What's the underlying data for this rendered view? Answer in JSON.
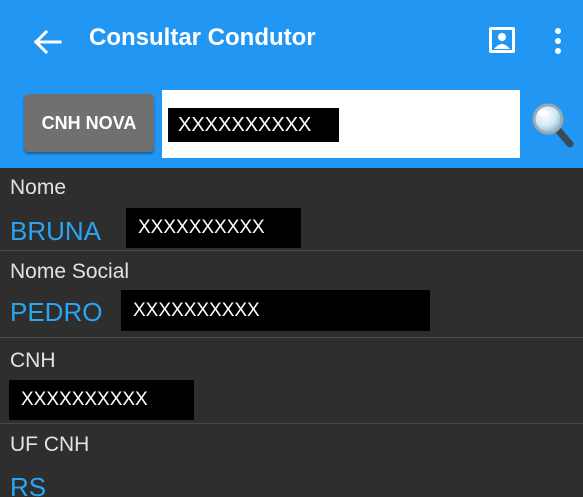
{
  "appbar": {
    "title": "Consultar Condutor",
    "back_icon": "arrow-left-icon",
    "contact_icon": "contact-card-icon",
    "menu_icon": "more-vert-icon",
    "color": "#2196f3"
  },
  "search": {
    "document_type_label": "CNH NOVA",
    "query_value": "XXXXXXXXXX",
    "search_icon": "magnifier-icon"
  },
  "fields": [
    {
      "label": "Nome",
      "value_prefix": "BRUNA",
      "value_redacted": "XXXXXXXXXX"
    },
    {
      "label": "Nome Social",
      "value_prefix": "PEDRO",
      "value_redacted": "XXXXXXXXXX"
    },
    {
      "label": "CNH",
      "value_prefix": "",
      "value_redacted": "XXXXXXXXXX"
    },
    {
      "label": "UF CNH",
      "value_prefix": "RS",
      "value_redacted": ""
    }
  ],
  "colors": {
    "accent": "#2196f3",
    "value_text": "#29a5f2",
    "background_dark": "#2e2e2e",
    "button_gray": "#707070"
  }
}
